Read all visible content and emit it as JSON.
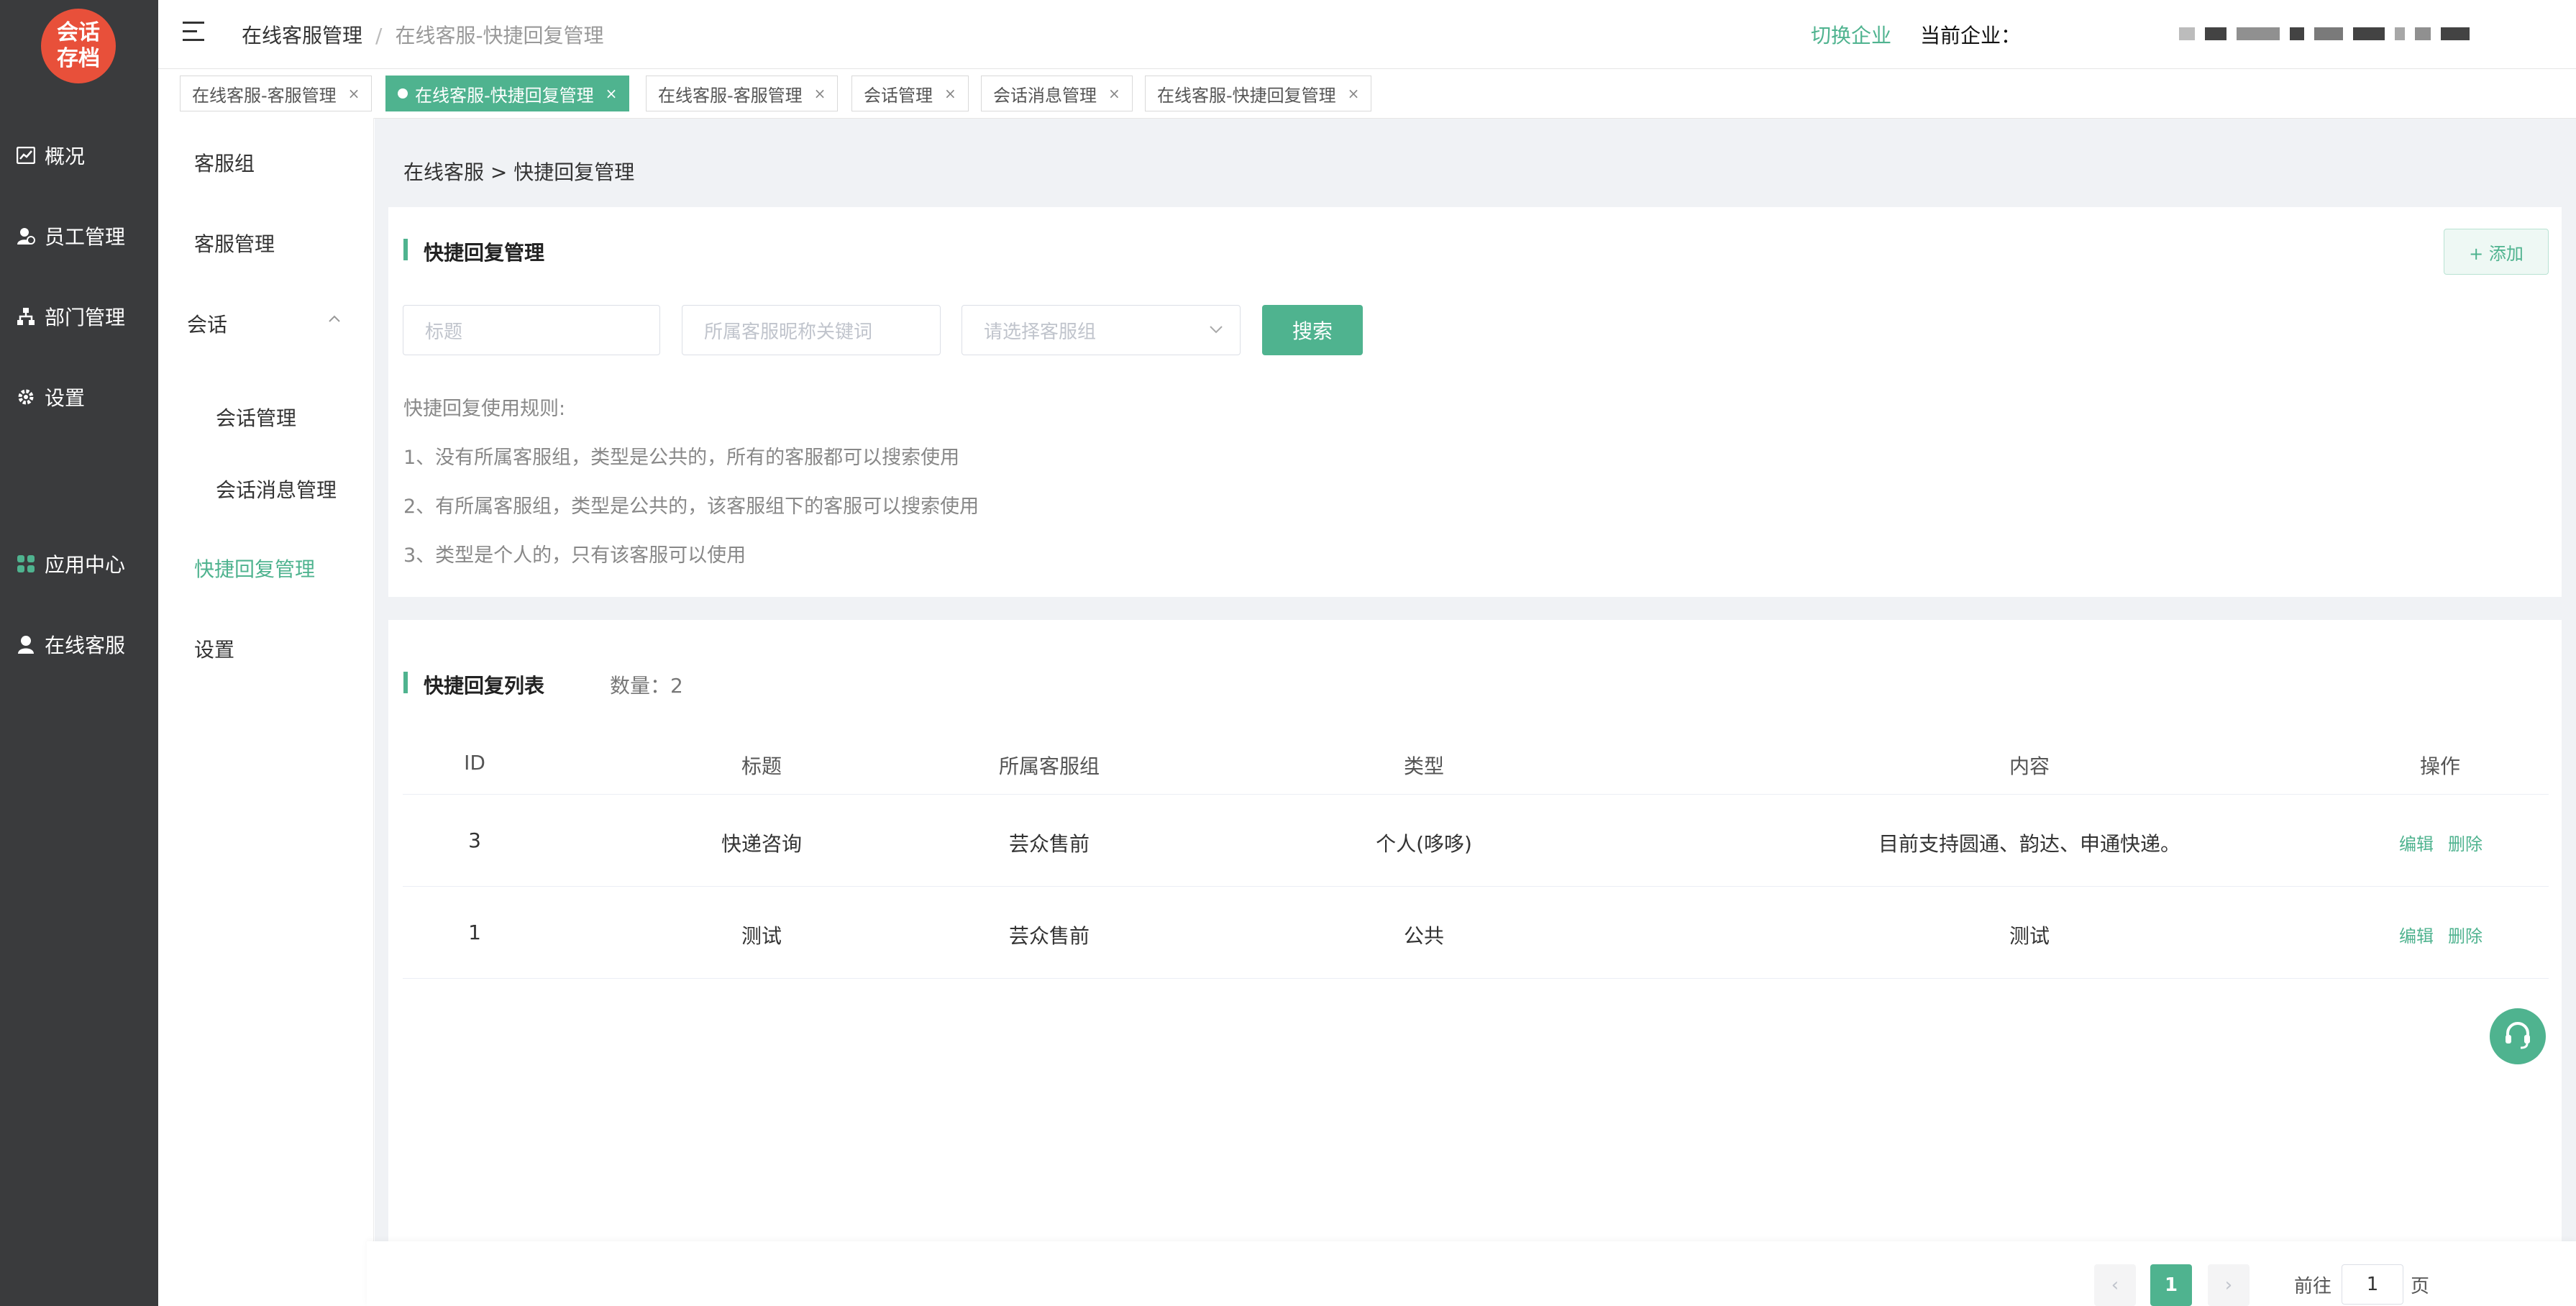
{
  "logo": {
    "line1": "会话",
    "line2": "存档"
  },
  "main_nav": [
    {
      "label": "概况",
      "icon": "chart-icon"
    },
    {
      "label": "员工管理",
      "icon": "user-icon"
    },
    {
      "label": "部门管理",
      "icon": "org-icon"
    },
    {
      "label": "设置",
      "icon": "gear-icon"
    },
    {
      "label": "应用中心",
      "icon": "grid-icon"
    },
    {
      "label": "在线客服",
      "icon": "agent-icon"
    }
  ],
  "sub_nav": {
    "kefu_group": "客服组",
    "kefu_manage": "客服管理",
    "session": "会话",
    "session_manage": "会话管理",
    "session_msg_manage": "会话消息管理",
    "quick_reply": "快捷回复管理",
    "settings": "设置"
  },
  "header": {
    "crumb_root": "在线客服管理",
    "crumb_sep": "/",
    "crumb_current": "在线客服-快捷回复管理",
    "switch_company": "切换企业",
    "current_label": "当前企业："
  },
  "tabs": [
    {
      "label": "在线客服-客服管理",
      "close": "×"
    },
    {
      "label": "在线客服-快捷回复管理",
      "close": "×"
    },
    {
      "label": "在线客服-客服管理",
      "close": "×"
    },
    {
      "label": "会话管理",
      "close": "×"
    },
    {
      "label": "会话消息管理",
      "close": "×"
    },
    {
      "label": "在线客服-快捷回复管理",
      "close": "×"
    }
  ],
  "page": {
    "breadcrumb": "在线客服 > 快捷回复管理",
    "filter_title": "快捷回复管理",
    "add_button": "+ 添加",
    "title_placeholder": "标题",
    "nickname_placeholder": "所属客服昵称关键词",
    "group_placeholder": "请选择客服组",
    "search_button": "搜索",
    "rules_title": "快捷回复使用规则:",
    "rules": [
      "1、没有所属客服组，类型是公共的，所有的客服都可以搜索使用",
      "2、有所属客服组，类型是公共的，该客服组下的客服可以搜索使用",
      "3、类型是个人的，只有该客服可以使用"
    ],
    "list_title": "快捷回复列表",
    "count_label": "数量：",
    "count_value": "2"
  },
  "table": {
    "headers": [
      "ID",
      "标题",
      "所属客服组",
      "类型",
      "内容",
      "操作"
    ],
    "rows": [
      {
        "id": "3",
        "title": "快递咨询",
        "group": "芸众售前",
        "type": "个人(哆哆)",
        "content": "目前支持圆通、韵达、申通快递。",
        "edit": "编辑",
        "delete": "删除"
      },
      {
        "id": "1",
        "title": "测试",
        "group": "芸众售前",
        "type": "公共",
        "content": "测试",
        "edit": "编辑",
        "delete": "删除"
      }
    ]
  },
  "pagination": {
    "prev": "‹",
    "current_page": "1",
    "next": "›",
    "goto_label": "前往",
    "goto_value": "1",
    "page_unit": "页"
  },
  "colors": {
    "accent": "#4fb38f",
    "sidebar_dark": "#3a3b3d",
    "logo": "#e8503a"
  }
}
